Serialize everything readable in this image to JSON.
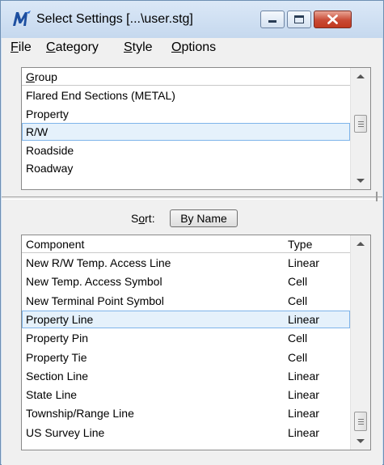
{
  "window": {
    "title": "Select Settings [...\\user.stg]",
    "title_bg": "#cfdff1",
    "close_color": "#c94a35"
  },
  "menu": [
    {
      "id": "file",
      "label": "File",
      "mnemonic": "F",
      "rest": "ile"
    },
    {
      "id": "category",
      "label": "Category",
      "mnemonic": "C",
      "rest": "ategory"
    },
    {
      "id": "style",
      "label": "Style",
      "mnemonic": "S",
      "rest": "tyle"
    },
    {
      "id": "options",
      "label": "Options",
      "mnemonic": "O",
      "rest": "ptions"
    }
  ],
  "group_list": {
    "header": "Group",
    "header_mnemonic": "G",
    "header_rest": "roup",
    "rows": [
      {
        "name": "Flared End Sections (METAL)",
        "selected": false
      },
      {
        "name": "Property",
        "selected": false
      },
      {
        "name": "R/W",
        "selected": true
      },
      {
        "name": "Roadside",
        "selected": false
      },
      {
        "name": "Roadway",
        "selected": false
      }
    ]
  },
  "sort": {
    "label": "Sort:",
    "label_before": "S",
    "label_mnemonic": "o",
    "label_after": "rt:",
    "button_label": "By Name"
  },
  "component_list": {
    "header_component": "Component",
    "header_type": "Type",
    "rows": [
      {
        "name": "New R/W Temp. Access Line",
        "type": "Linear",
        "selected": false
      },
      {
        "name": "New Temp. Access Symbol",
        "type": "Cell",
        "selected": false
      },
      {
        "name": "New Terminal Point Symbol",
        "type": "Cell",
        "selected": false
      },
      {
        "name": "Property Line",
        "type": "Linear",
        "selected": true
      },
      {
        "name": "Property Pin",
        "type": "Cell",
        "selected": false
      },
      {
        "name": "Property Tie",
        "type": "Cell",
        "selected": false
      },
      {
        "name": "Section Line",
        "type": "Linear",
        "selected": false
      },
      {
        "name": "State Line",
        "type": "Linear",
        "selected": false
      },
      {
        "name": "Township/Range Line",
        "type": "Linear",
        "selected": false
      },
      {
        "name": "US Survey Line",
        "type": "Linear",
        "selected": false
      }
    ]
  },
  "colors": {
    "selection_fill": "#e5f1fb",
    "selection_border": "#7eb4ea"
  }
}
